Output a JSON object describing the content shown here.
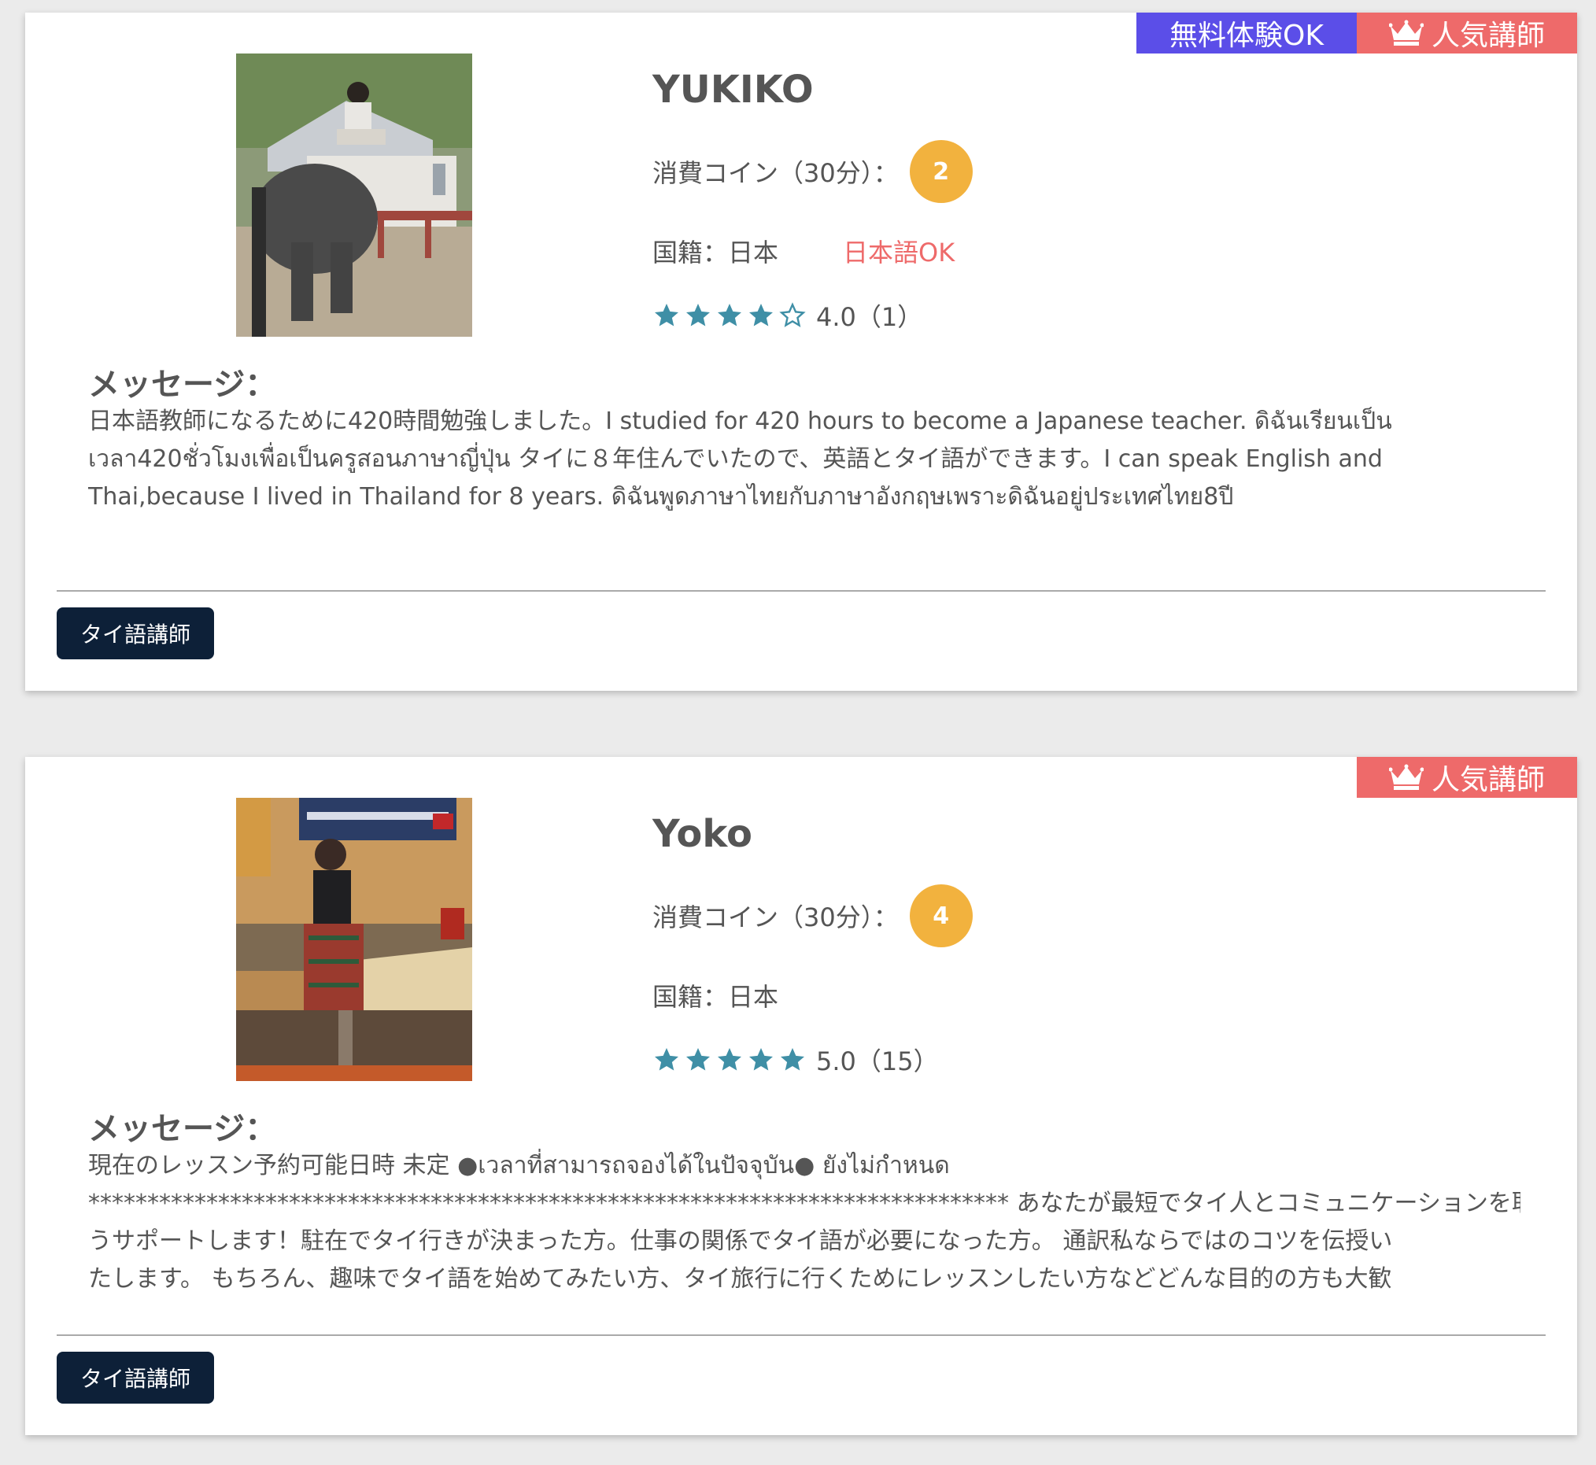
{
  "colors": {
    "trial_badge": "#5b4ee8",
    "popular_badge": "#ee6a6a",
    "coin": "#f2b23e",
    "star": "#3f8fa6",
    "jp_ok": "#ee6a6a",
    "tag_button": "#0d2038"
  },
  "teachers": [
    {
      "badges": {
        "trial": "無料体験OK",
        "popular": "人気講師"
      },
      "photo_alt": "teacher photo",
      "name": "YUKIKO",
      "coin_label": "消費コイン（30分）：",
      "coin_value": "2",
      "nationality": "国籍：日本",
      "japanese_ok": "日本語OK",
      "rating": {
        "stars": 4,
        "text": "4.0（1）"
      },
      "message_title": "メッセージ：",
      "message_lines": [
        "日本語教師になるために420時間勉強しました。I studied for 420 hours to become a Japanese teacher. ดิฉันเรียนเป็น",
        "เวลา420ชั่วโมงเพื่อเป็นครูสอนภาษาญี่ปุ่น タイに８年住んでいたので、英語とタイ語ができます。I can speak English and",
        "Thai,because I lived in Thailand for 8 years. ดิฉันพูดภาษาไทยกับภาษาอังกฤษเพราะดิฉันอยู่ประเทศไทย8ปี"
      ],
      "tag": "タイ語講師"
    },
    {
      "badges": {
        "popular": "人気講師"
      },
      "photo_alt": "teacher photo",
      "name": "Yoko",
      "coin_label": "消費コイン（30分）：",
      "coin_value": "4",
      "nationality": "国籍：日本",
      "rating": {
        "stars": 5,
        "text": "5.0（15）"
      },
      "message_title": "メッセージ：",
      "message_lines": [
        "現在のレッスン予約可能日時 未定 ●เวลาที่สามารถจองได้ในปัจจุบัน● ยังไม่กำหนด",
        "****************************************************************************** あなたが最短でタイ人とコミュニケーションを取れるよ",
        "うサポートします！駐在でタイ行きが決まった方。仕事の関係でタイ語が必要になった方。 通訳私ならではのコツを伝授い",
        "たします。 もちろん、趣味でタイ語を始めてみたい方、タイ旅行に行くためにレッスンしたい方などどんな目的の方も大歓"
      ],
      "tag": "タイ語講師"
    }
  ]
}
